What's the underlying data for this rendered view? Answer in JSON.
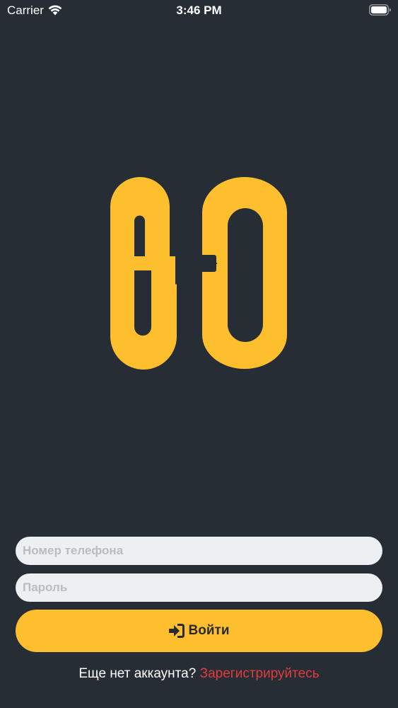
{
  "status_bar": {
    "carrier": "Carrier",
    "time": "3:46 PM"
  },
  "colors": {
    "background": "#262d35",
    "accent": "#fdbf2d",
    "input_background": "#edf0f2",
    "link": "#e23b3b"
  },
  "logo": {
    "text": "GO",
    "icon": "arrow-right-icon"
  },
  "form": {
    "phone_placeholder": "Номер телефона",
    "password_placeholder": "Пароль",
    "login_icon": "sign-in-icon",
    "login_label": "Войти"
  },
  "footer": {
    "prompt": "Еще нет аккаунта?",
    "register_link": "Зарегистрируйтесь"
  }
}
